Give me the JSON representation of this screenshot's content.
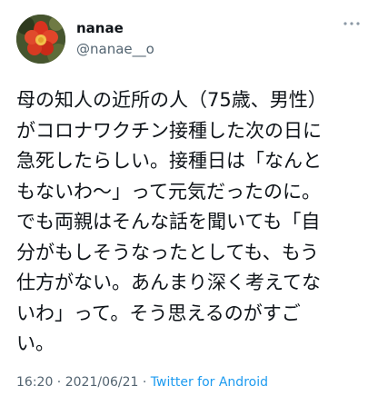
{
  "user": {
    "display_name": "nanae",
    "handle": "@nanae__o"
  },
  "tweet": {
    "text": "母の知人の近所の人（75歳、男性）\nがコロナワクチン接種した次の日に\n急死したらしい。接種日は「なんと\nもないわ〜」って元気だったのに。\nでも両親はそんな話を聞いても「自\n分がもしそうなったとしても、もう\n仕方がない。あんまり深く考えてな\nいわ」って。そう思えるのがすご\nい。",
    "time": "16:20",
    "separator": " · ",
    "date": "2021/06/21",
    "source": "Twitter for Android"
  },
  "icons": {
    "avatar": "flower-avatar-icon",
    "more": "more-dots-icon"
  },
  "colors": {
    "text": "#0f1419",
    "secondary": "#536471",
    "link": "#1d9bf0"
  }
}
